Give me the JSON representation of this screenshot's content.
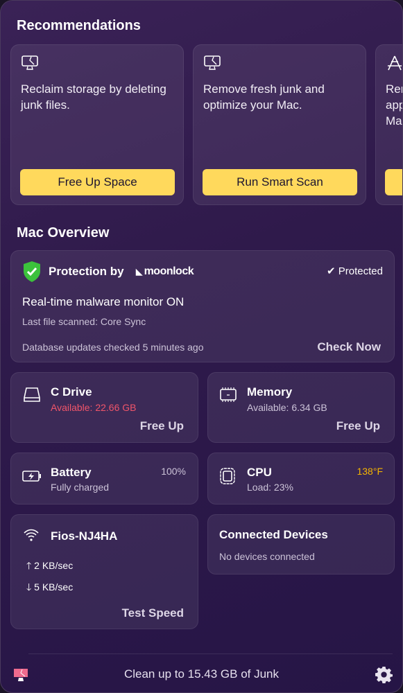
{
  "recommendations": {
    "title": "Recommendations",
    "cards": [
      {
        "icon": "cleanmymac-monitor-icon",
        "text": "Reclaim storage by deleting junk files.",
        "button": "Free Up Space"
      },
      {
        "icon": "cleanmymac-monitor-icon",
        "text": "Remove fresh junk and optimize your Mac.",
        "button": "Run Smart Scan"
      },
      {
        "icon": "applications-icon",
        "lines": [
          "Rem",
          "app",
          "Mac"
        ]
      }
    ]
  },
  "overview": {
    "title": "Mac Overview",
    "protection": {
      "title": "Protection by",
      "brand": "moonlock",
      "status": "Protected",
      "monitor": "Real-time malware monitor ON",
      "last_scanned": "Last file scanned: Core Sync",
      "db_updates": "Database updates checked 5 minutes ago",
      "action": "Check Now"
    },
    "drive": {
      "title": "C Drive",
      "available": "Available: 22.66 GB",
      "action": "Free Up"
    },
    "memory": {
      "title": "Memory",
      "available": "Available: 6.34 GB",
      "action": "Free Up"
    },
    "battery": {
      "title": "Battery",
      "status": "Fully charged",
      "percent": "100%"
    },
    "cpu": {
      "title": "CPU",
      "load": "Load: 23%",
      "temp": "138°F"
    },
    "network": {
      "title": "Fios-NJ4HA",
      "upload": "2 KB/sec",
      "download": "5 KB/sec",
      "action": "Test Speed"
    },
    "devices": {
      "title": "Connected Devices",
      "status": "No devices connected"
    }
  },
  "footer": {
    "text": "Clean up to 15.43 GB of Junk"
  },
  "colors": {
    "accent": "#ffd95c",
    "warning": "#f0556a",
    "temp": "#f5b400",
    "shield": "#3cc23c"
  }
}
